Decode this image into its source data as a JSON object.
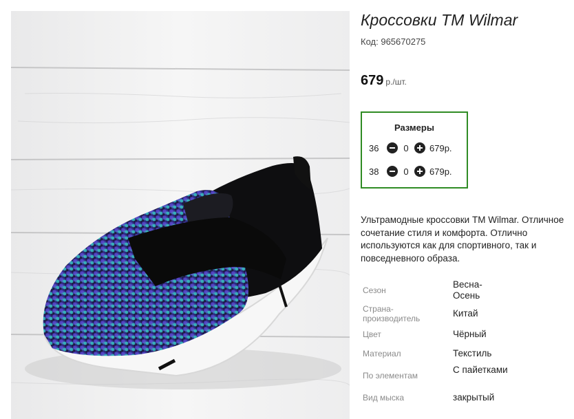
{
  "product": {
    "title": "Кроссовки ТМ Wilmar",
    "code_label": "Код:",
    "code_value": "965670275",
    "price_value": "679",
    "price_unit": "р./шт.",
    "image_alt": "sequin slip-on sneaker photo"
  },
  "sizes": {
    "title": "Размеры",
    "rows": [
      {
        "size": "36",
        "qty": "0",
        "price": "679р."
      },
      {
        "size": "38",
        "qty": "0",
        "price": "679р."
      }
    ]
  },
  "description": "Ультрамодные кроссовки ТМ Wilmar. Отличное сочетание стиля и комфорта. Отлично используются как для спортивного, так и повседневного образа.",
  "specs": [
    {
      "label": "Сезон",
      "value": "Весна-Осень"
    },
    {
      "label": "Страна-производитель",
      "value": "Китай"
    },
    {
      "label": "Цвет",
      "value": "Чёрный"
    },
    {
      "label": "Материал",
      "value": "Текстиль"
    },
    {
      "label": "По элементам",
      "value": "С пайетками"
    },
    {
      "label": "Вид мыска",
      "value": "закрытый"
    }
  ],
  "colors": {
    "sizes_border": "#2e8b23",
    "spec_label": "#8a8a8a",
    "button_fill": "#222222"
  },
  "icons": {
    "minus": "minus-circle-icon",
    "plus": "plus-circle-icon"
  }
}
